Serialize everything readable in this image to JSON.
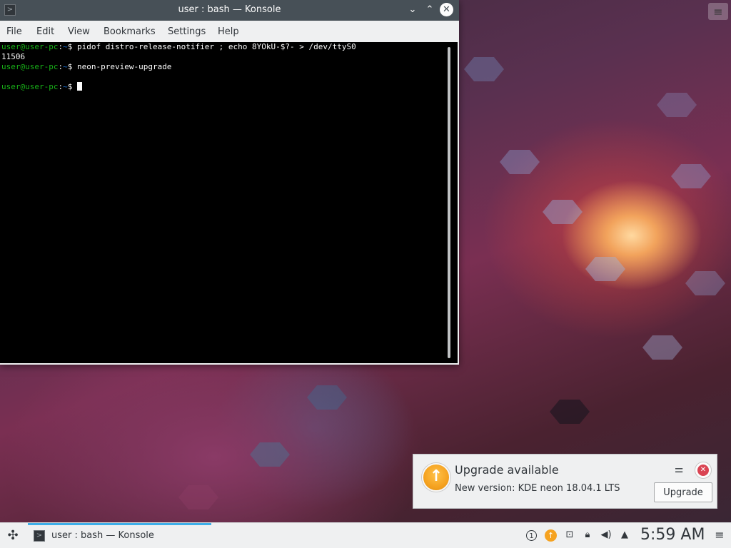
{
  "window": {
    "title": "user : bash — Konsole",
    "app_icon": "terminal-icon",
    "controls": [
      "minimize-icon",
      "maximize-icon",
      "close-icon"
    ]
  },
  "menubar": {
    "file": "File",
    "edit": "Edit",
    "view": "View",
    "bookmarks": "Bookmarks",
    "settings": "Settings",
    "help": "Help"
  },
  "terminal": {
    "prompt_user": "user@user-pc",
    "prompt_path": "~",
    "prompt_symbol": "$",
    "lines": [
      {
        "command": " pidof distro-release-notifier ; echo 8YOkU-$?- > /dev/ttyS0"
      },
      {
        "output": "11506"
      },
      {
        "command": " neon-preview-upgrade"
      },
      {
        "command": " "
      }
    ]
  },
  "notification": {
    "title": "Upgrade available",
    "body": "New version: KDE neon 18.04.1 LTS",
    "button": "Upgrade",
    "icon": "upgrade-arrow-icon",
    "settings_icon": "settings-sliders-icon",
    "close_icon": "close-icon"
  },
  "taskbar": {
    "launcher_icon": "application-launcher-icon",
    "task_label": "user : bash — Konsole",
    "task_icon": "terminal-icon",
    "tray": {
      "notification_count": "1",
      "icons": [
        "notification-count-icon",
        "upgrade-icon",
        "network-icon",
        "lock-icon",
        "volume-icon",
        "expand-tray-icon"
      ]
    },
    "clock": "5:59 AM",
    "panel_menu_icon": "hamburger-menu-icon"
  },
  "colors": {
    "titlebar": "#475057",
    "terminal_bg": "#000000",
    "prompt_user": "#18b218",
    "prompt_path": "#1871d8",
    "accent": "#3daee9",
    "close_red": "#da4453",
    "upgrade_orange": "#f5a220"
  }
}
